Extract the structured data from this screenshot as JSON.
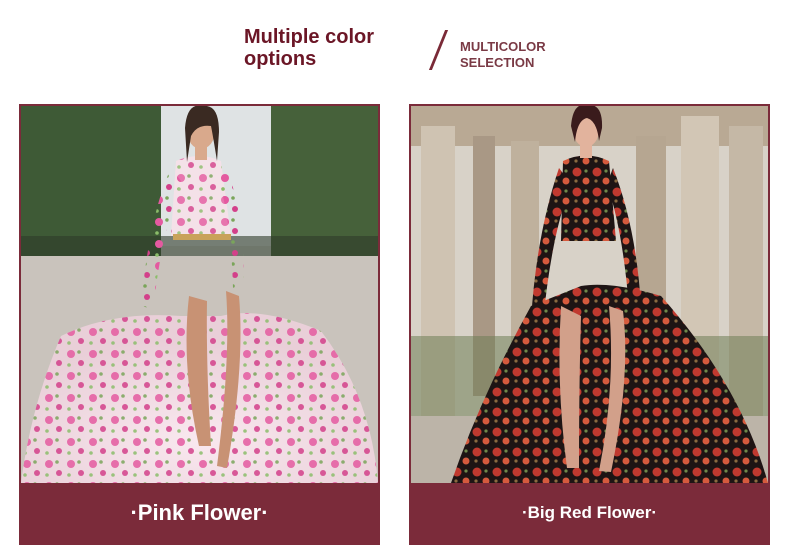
{
  "header": {
    "title": "Multiple color options",
    "subtitle": "MULTICOLOR SELECTION"
  },
  "products": [
    {
      "label": "·Pink Flower·",
      "accent": "#e5529a",
      "background": "#f6e7ee"
    },
    {
      "label": "·Big Red Flower·",
      "accent": "#c2342f",
      "background": "#2a1a1a"
    }
  ],
  "colors": {
    "brand": "#7b2b3a",
    "title": "#6b1626"
  }
}
